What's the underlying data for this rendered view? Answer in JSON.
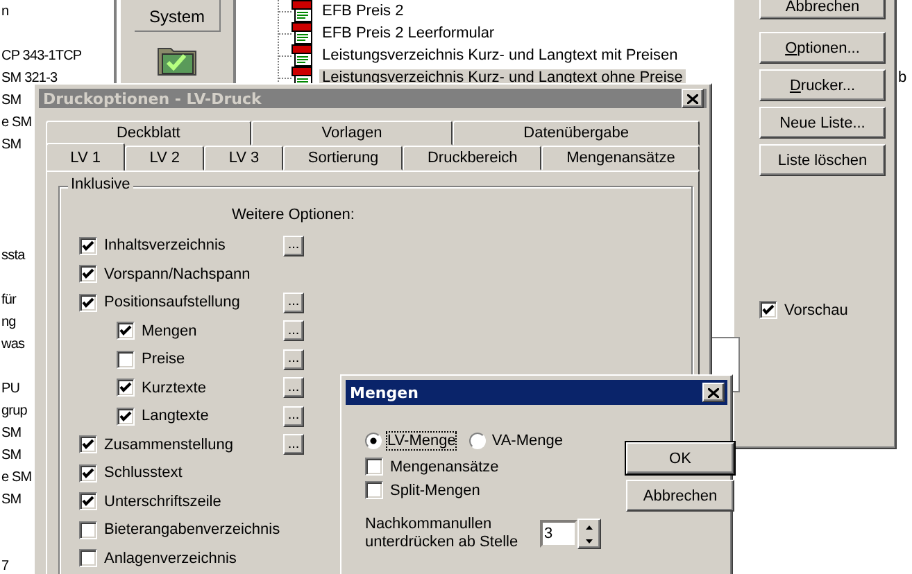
{
  "background_list": {
    "groups": [
      [
        "n"
      ],
      [
        "CP 343-1TCP",
        "SM 321-3",
        "SM",
        "e SM",
        "SM"
      ],
      [
        "ssta"
      ],
      [
        "für",
        "ng",
        "was"
      ],
      [
        "PU",
        "grup",
        "SM",
        "SM",
        "e SM",
        "SM"
      ],
      [
        "7"
      ]
    ]
  },
  "side_panel": {
    "button": "System"
  },
  "tree": {
    "items": [
      {
        "label": "EFB Preis 2",
        "selected": false
      },
      {
        "label": "EFB Preis 2 Leerformular",
        "selected": false
      },
      {
        "label": "Leistungsverzeichnis Kurz- und Langtext mit Preisen",
        "selected": false
      },
      {
        "label": "Leistungsverzeichnis Kurz- und Langtext ohne Preise",
        "selected": true
      }
    ]
  },
  "right_window": {
    "buttons": [
      {
        "label": "Abbrechen",
        "underline_first": false
      },
      {
        "label": "Optionen...",
        "underline_first": true
      },
      {
        "label": "Drucker...",
        "underline_first": true
      },
      {
        "label": "Neue Liste...",
        "underline_first": false
      },
      {
        "label": "Liste löschen",
        "underline_first": false
      }
    ],
    "preview": {
      "label": "Vorschau",
      "checked": true
    },
    "side_text": "b"
  },
  "main_dialog": {
    "title": "Druckoptionen - LV-Druck",
    "active": false,
    "tab_rows": [
      [
        {
          "label": "Deckblatt",
          "selected": false
        },
        {
          "label": "Vorlagen",
          "selected": false
        },
        {
          "label": "Datenübergabe",
          "selected": false
        }
      ],
      [
        {
          "label": "LV 1",
          "selected": true
        },
        {
          "label": "LV 2",
          "selected": false
        },
        {
          "label": "LV 3",
          "selected": false
        },
        {
          "label": "Sortierung",
          "selected": false
        },
        {
          "label": "Druckbereich",
          "selected": false
        },
        {
          "label": "Mengenansätze",
          "selected": false
        }
      ]
    ],
    "group": {
      "title": "Inklusive",
      "subtitle": "Weitere Optionen:",
      "options": [
        {
          "label": "Inhaltsverzeichnis",
          "checked": true,
          "more": "..."
        },
        {
          "label": "Vorspann/Nachspann",
          "checked": true
        },
        {
          "label": "Positionsaufstellung",
          "checked": true,
          "more": "...",
          "children": [
            {
              "label": "Mengen",
              "checked": true,
              "more": "..."
            },
            {
              "label": "Preise",
              "checked": false,
              "more": "..."
            },
            {
              "label": "Kurztexte",
              "checked": true,
              "more": "..."
            },
            {
              "label": "Langtexte",
              "checked": true,
              "more": "..."
            }
          ]
        },
        {
          "label": "Zusammenstellung",
          "checked": true,
          "more": "..."
        },
        {
          "label": "Schlusstext",
          "checked": true
        },
        {
          "label": "Unterschriftszeile",
          "checked": true
        },
        {
          "label": "Bieterangabenverzeichnis",
          "checked": false
        },
        {
          "label": "Anlagenverzeichnis",
          "checked": false
        }
      ]
    }
  },
  "mengen_dialog": {
    "title": "Mengen",
    "active": true,
    "radios": [
      {
        "label": "LV-Menge",
        "selected": true
      },
      {
        "label": "VA-Menge",
        "selected": false
      }
    ],
    "checkboxes": [
      {
        "label": "Mengenansätze",
        "checked": false
      },
      {
        "label": "Split-Mengen",
        "checked": false
      }
    ],
    "spin": {
      "label": "Nachkommanullen unterdrücken ab Stelle",
      "value": "3"
    },
    "buttons": [
      "OK",
      "Abbrechen"
    ]
  }
}
